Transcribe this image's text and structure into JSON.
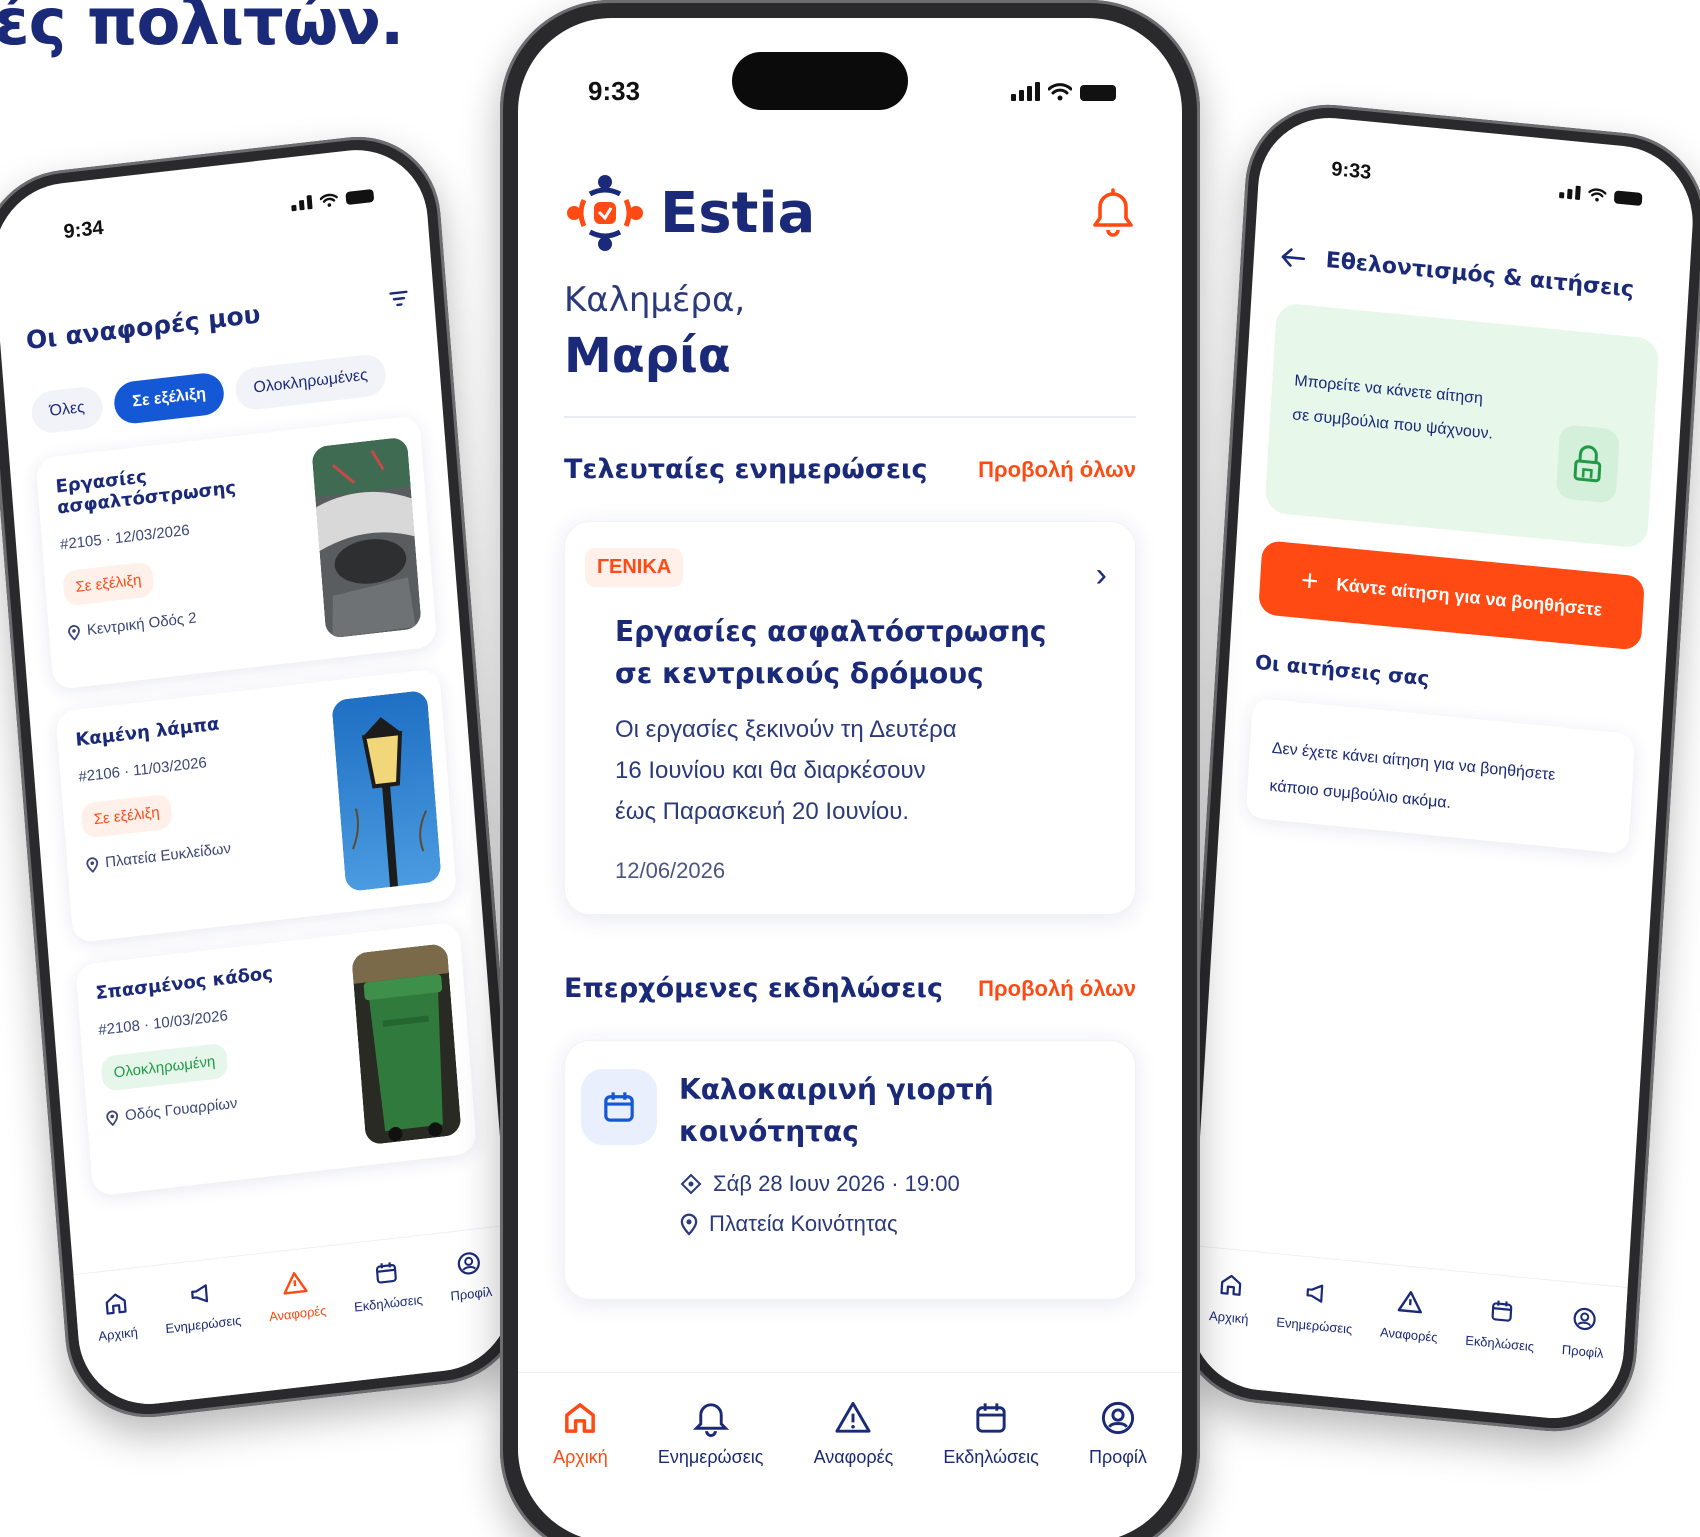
{
  "headline": "ές πολιτών.",
  "colors": {
    "brand_navy": "#1b2a78",
    "accent_orange": "#ff4a14",
    "chip_blue": "#1558d6",
    "success_green": "#1f9a47"
  },
  "left_phone": {
    "time": "9:34",
    "title": "Οι αναφορές μου",
    "filters": [
      "Όλες",
      "Σε εξέλιξη",
      "Ολοκληρωμένες"
    ],
    "reports": [
      {
        "title": "Εργασίες ασφαλτόστρωσης",
        "id_date": "#2105 · 12/03/2026",
        "status": "Σε εξέλιξη",
        "location": "Κεντρική Οδός 2",
        "image": "road-photo"
      },
      {
        "title": "Καμένη λάμπα",
        "id_date": "#2106 · 11/03/2026",
        "status": "Σε εξέλιξη",
        "location": "Πλατεία Ευκλείδων",
        "image": "streetlamp-photo"
      },
      {
        "title": "Σπασμένος κάδος",
        "id_date": "#2108 · 10/03/2026",
        "status": "Ολοκληρωμένη",
        "location": "Οδός Γουαρρίων",
        "image": "trash-bin-photo"
      }
    ],
    "tabs": [
      "Αρχική",
      "Ενημερώσεις",
      "Αναφορές",
      "Εκδηλώσεις",
      "Προφίλ"
    ]
  },
  "center_phone": {
    "time": "9:33",
    "app_name": "Estia",
    "greeting": "Καλημέρα,",
    "user_name": "Μαρία",
    "updates_title": "Τελευταίες ενημερώσεις",
    "view_all": "Προβολή όλων",
    "news": {
      "tag": "ΓΕΝΙΚΑ",
      "title_line1": "Εργασίες ασφαλτόστρωσης",
      "title_line2": "σε κεντρικούς δρόμους",
      "body_line1": "Οι εργασίες ξεκινούν τη Δευτέρα",
      "body_line2": "16 Ιουνίου και θα διαρκέσουν",
      "body_line3": "έως Παρασκευή 20 Ιουνίου.",
      "date": "12/06/2026"
    },
    "events_title": "Επερχόμενες εκδηλώσεις",
    "event": {
      "title_line1": "Καλοκαιρινή γιορτή",
      "title_line2": "κοινότητας",
      "datetime": "Σάβ 28 Ιουν 2026 · 19:00",
      "location": "Πλατεία Κοινότητας"
    },
    "tabs": [
      "Αρχική",
      "Ενημερώσεις",
      "Αναφορές",
      "Εκδηλώσεις",
      "Προφίλ"
    ]
  },
  "right_phone": {
    "time": "9:33",
    "title": "Εθελοντισμός & αιτήσεις",
    "info_line1": "Μπορείτε να κάνετε αίτηση",
    "info_line2": "σε συμβούλια που ψάχνουν.",
    "cta": "Κάντε αίτηση για να βοηθήσετε",
    "applications_title": "Οι αιτήσεις σας",
    "empty_line1": "Δεν έχετε κάνει αίτηση για να βοηθήσετε",
    "empty_line2": "κάποιο συμβούλιο ακόμα.",
    "tabs": [
      "Αρχική",
      "Ενημερώσεις",
      "Αναφορές",
      "Εκδηλώσεις",
      "Προφίλ"
    ]
  }
}
